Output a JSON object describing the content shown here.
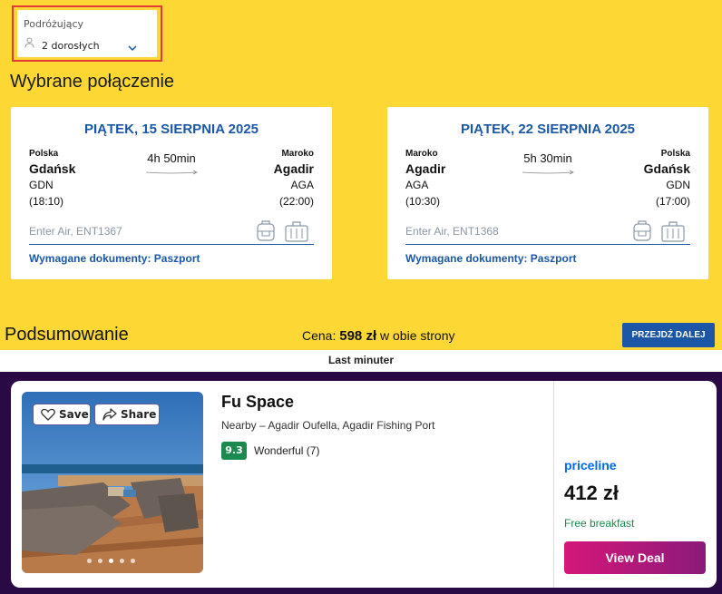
{
  "travelers": {
    "label": "Podróżujący",
    "value": "2 dorosłych"
  },
  "section_title": "Wybrane połączenie",
  "outbound": {
    "date": "PIĄTEK, 15 SIERPNIA 2025",
    "from_country": "Polska",
    "from_city": "Gdańsk",
    "from_code": "GDN",
    "from_time": "(18:10)",
    "duration": "4h 50min",
    "to_country": "Maroko",
    "to_city": "Agadir",
    "to_code": "AGA",
    "to_time": "(22:00)",
    "flight": "Enter Air, ENT1367",
    "docs": "Wymagane dokumenty: Paszport"
  },
  "return": {
    "date": "PIĄTEK, 22 SIERPNIA 2025",
    "from_country": "Maroko",
    "from_city": "Agadir",
    "from_code": "AGA",
    "from_time": "(10:30)",
    "duration": "5h 30min",
    "to_country": "Polska",
    "to_city": "Gdańsk",
    "to_code": "GDN",
    "to_time": "(17:00)",
    "flight": "Enter Air, ENT1368",
    "docs": "Wymagane dokumenty: Paszport"
  },
  "summary": {
    "title": "Podsumowanie",
    "price_label": "Cena:",
    "price_value": "598 zł",
    "price_suffix": "w obie strony",
    "next_button": "PRZEJDŹ DALEJ"
  },
  "ad": {
    "logo": "Last minuter",
    "save_label": "Save",
    "share_label": "Share",
    "hotel_name": "Fu Space",
    "location": "Nearby – Agadir Oufella, Agadir Fishing Port",
    "rating": "9.3",
    "rating_text": "Wonderful (7)",
    "provider": "priceline",
    "price": "412 zł",
    "perk": "Free breakfast",
    "deal_button": "View Deal",
    "photo_count": 5,
    "active_photo": 3
  },
  "colors": {
    "yellow": "#fdd835",
    "blue": "#1b57a6",
    "purple": "#2a0a44",
    "green": "#1a8a4e"
  }
}
